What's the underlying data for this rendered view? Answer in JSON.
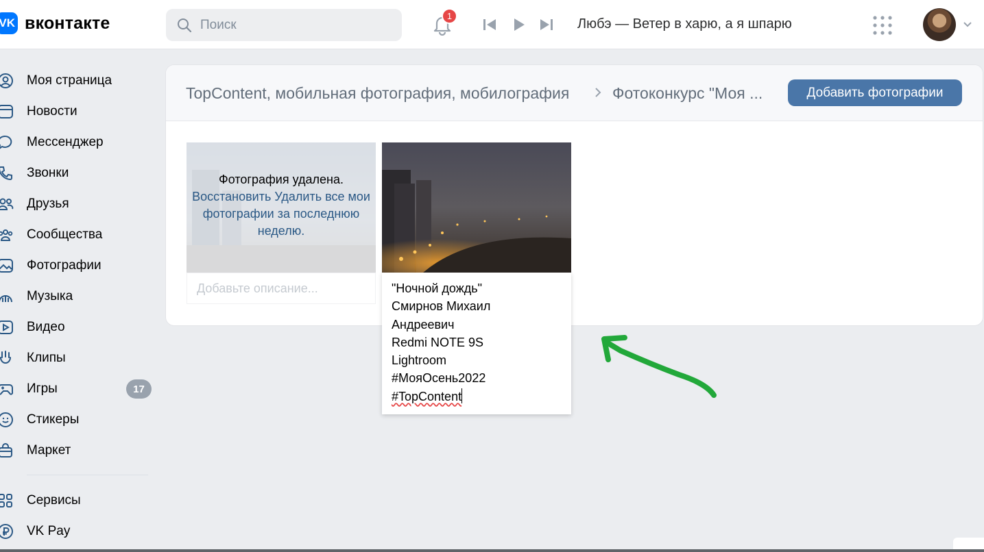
{
  "brand": {
    "logo_mark": "VK",
    "name": "вконтакте"
  },
  "search": {
    "placeholder": "Поиск"
  },
  "notifications": {
    "count": "1"
  },
  "player": {
    "track": "Любэ — Ветер в харю, а я шпарю"
  },
  "sidebar": {
    "items": [
      {
        "label": "Моя страница",
        "icon": "user-circle-icon"
      },
      {
        "label": "Новости",
        "icon": "news-icon"
      },
      {
        "label": "Мессенджер",
        "icon": "message-icon"
      },
      {
        "label": "Звонки",
        "icon": "phone-icon"
      },
      {
        "label": "Друзья",
        "icon": "friends-icon"
      },
      {
        "label": "Сообщества",
        "icon": "communities-icon"
      },
      {
        "label": "Фотографии",
        "icon": "photo-icon"
      },
      {
        "label": "Музыка",
        "icon": "music-icon"
      },
      {
        "label": "Видео",
        "icon": "video-icon"
      },
      {
        "label": "Клипы",
        "icon": "clips-icon"
      },
      {
        "label": "Игры",
        "icon": "gamepad-icon",
        "badge": "17"
      },
      {
        "label": "Стикеры",
        "icon": "smile-icon"
      },
      {
        "label": "Маркет",
        "icon": "market-bag-icon"
      },
      {
        "label": "Сервисы",
        "icon": "services-icon"
      },
      {
        "label": "VK Pay",
        "icon": "ruble-icon"
      }
    ]
  },
  "album": {
    "breadcrumb_group": "TopContent, мобильная фотография, мобилография",
    "breadcrumb_album": "Фотоконкурс \"Моя ...",
    "add_button": "Добавить фотографии"
  },
  "photos": [
    {
      "deleted_text": "Фотография удалена.",
      "restore_link": "Восстановить",
      "delete_all_link": "Удалить все мои фотографии за последнюю неделю.",
      "description_placeholder": "Добавьте описание..."
    },
    {
      "description_lines": [
        "\"Ночной дождь\"",
        "Смирнов Михаил",
        "Андреевич",
        "Redmi NOTE 9S",
        "Lightroom",
        "#МояОсень2022",
        "#TopContent"
      ]
    }
  ],
  "colors": {
    "accent": "#4a76a8",
    "link": "#2a5885",
    "brand": "#0077ff",
    "badge_red": "#e64646",
    "annotation_arrow": "#22a83a"
  }
}
